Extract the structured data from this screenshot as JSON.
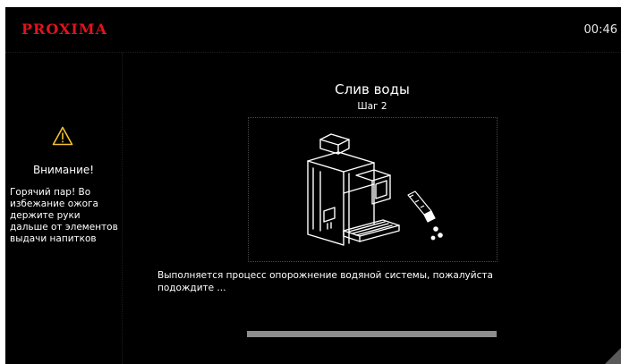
{
  "header": {
    "brand": "PROXIMA",
    "time": "00:46"
  },
  "sidebar": {
    "icon": "warning-triangle-icon",
    "title": "Внимание!",
    "text": "Горячий пар! Во избежание ожога держите руки дальше от элементов выдачи напитков"
  },
  "main": {
    "title": "Слив воды",
    "step": "Шаг 2",
    "illustration_icon": "coffee-machine-drain-icon",
    "message": "Выполняется процесс опорожнение водяной системы, пожалуйста подождите ...",
    "progress": 1.0
  },
  "colors": {
    "background": "#000000",
    "brand": "#e3131b",
    "text": "#ffffff",
    "progress_track": "#3a3a3a",
    "progress_fill": "#8e8e8e"
  }
}
